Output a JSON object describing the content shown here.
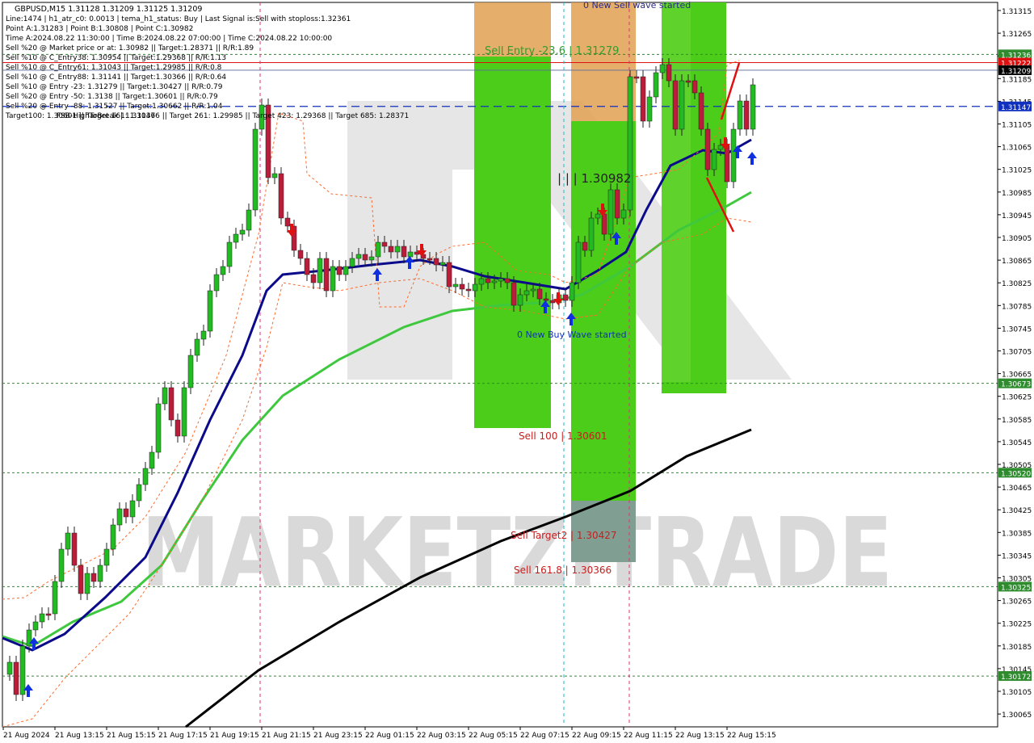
{
  "header": {
    "symbol_line": "GBPUSD,M15  1.31128 1.31209 1.31125 1.31209",
    "info_lines": [
      "Line:1474  |  h1_atr_c0: 0.0013  |  tema_h1_status: Buy  |  Last Signal is:Sell with stoploss:1.32361",
      "Point A:1.31283  |  Point B:1.30808  |  Point C:1.30982",
      "Time A:2024.08.22 11:30:00  |  Time B:2024.08.22 07:00:00  |  Time C:2024.08.22 10:00:00",
      "Sell %20 @ Market price or at: 1.30982  ||  Target:1.28371  ||  R/R:1.89",
      "Sell %10 @ C_Entry38: 1.30954  ||  Target:1.29368  ||  R/R:1.13",
      "Sell %10 @ C_Entry61: 1.31043  ||  Target:1.29985  ||  R/R:0.8",
      "Sell %10 @ C_Entry88: 1.31141  ||  Target:1.30366  ||  R/R:0.64",
      "Sell %10 @ Entry -23: 1.31279  ||  Target:1.30427  ||  R/R:0.79",
      "Sell %20 @ Entry -50: 1.3138  ||  Target:1.30601  ||  R/R:0.79",
      "Sell %20 @ Entry -88: 1.31527  ||  Target:1.30662  ||  R/R:1.04",
      "Target100: 1.30601  ||  Target 161: 1.30366  ||  Target 261: 1.29985  ||  Target 423: 1.29368  ||  Target 685: 1.28371"
    ],
    "fsb_label": "FSB-HighToBreak  |  1.31147"
  },
  "watermark": "MARKETZITRADE",
  "chart_data": {
    "type": "candlestick",
    "symbol": "GBPUSD",
    "timeframe": "M15",
    "ylim": [
      1.30085,
      1.31325
    ],
    "y_ticks": [
      "1.31325",
      "1.31285",
      "1.31245",
      "1.31205",
      "1.31165",
      "1.31125",
      "1.31085",
      "1.31045",
      "1.31005",
      "1.30965",
      "1.30925",
      "1.30885",
      "1.30845",
      "1.30805",
      "1.30765",
      "1.30725",
      "1.30685",
      "1.30645",
      "1.30605",
      "1.30565",
      "1.30525",
      "1.30485",
      "1.30445",
      "1.30405",
      "1.30365",
      "1.30325",
      "1.30285",
      "1.30245",
      "1.30205",
      "1.30165",
      "1.30125",
      "1.30085"
    ],
    "y_tick_labels": [
      "1.31315",
      "1.31265",
      "1.31225",
      "1.31185",
      "1.31145",
      "1.31105",
      "1.31065",
      "1.31025",
      "1.30985",
      "1.30945",
      "1.30905",
      "1.30865",
      "1.30825",
      "1.30785",
      "1.30745",
      "1.30705",
      "1.30665",
      "1.30625",
      "1.30585",
      "1.30545",
      "1.30505",
      "1.30465",
      "1.30425",
      "1.30385",
      "1.30345",
      "1.30305",
      "1.30265",
      "1.30225",
      "1.30185",
      "1.30145",
      "1.30105",
      "1.30065"
    ],
    "x_labels": [
      "21 Aug 2024",
      "21 Aug 13:15",
      "21 Aug 15:15",
      "21 Aug 17:15",
      "21 Aug 19:15",
      "21 Aug 21:15",
      "21 Aug 23:15",
      "22 Aug 01:15",
      "22 Aug 03:15",
      "22 Aug 05:15",
      "22 Aug 07:15",
      "22 Aug 09:15",
      "22 Aug 11:15",
      "22 Aug 13:15",
      "22 Aug 15:15"
    ],
    "price_tags": [
      {
        "label": "1.31236",
        "value": 1.31236,
        "color": "#2e8b2e"
      },
      {
        "label": "1.31222",
        "value": 1.31222,
        "color": "#e01010"
      },
      {
        "label": "1.31209",
        "value": 1.31209,
        "color": "#000000"
      },
      {
        "label": "1.31147",
        "value": 1.31147,
        "color": "#1030c0"
      },
      {
        "label": "1.30673",
        "value": 1.30673,
        "color": "#2e8b2e"
      },
      {
        "label": "1.30520",
        "value": 1.3052,
        "color": "#2e8b2e"
      },
      {
        "label": "1.30325",
        "value": 1.30325,
        "color": "#2e8b2e"
      },
      {
        "label": "1.30172",
        "value": 1.30172,
        "color": "#2e8b2e"
      }
    ],
    "annotations": [
      {
        "text": "Sell Entry -23.6 | 1.31279",
        "color": "#2e9e2e"
      },
      {
        "text": "0 New Sell wave started",
        "color": "#2a2a8a"
      },
      {
        "text": "| | | 1.30982",
        "color": "#222222"
      },
      {
        "text": "0 New Buy Wave started",
        "color": "#1030c0"
      },
      {
        "text": "Sell 100 | 1.30601",
        "color": "#c81e1e"
      },
      {
        "text": "Sell Target2 | 1.30427",
        "color": "#c81e1e"
      },
      {
        "text": "Sell 161.8 | 1.30366",
        "color": "#c81e1e"
      }
    ],
    "colors": {
      "bull": "#22bb22",
      "bear": "#bb1c3a",
      "zone_green": "#4ccd19",
      "zone_orange": "#e0a050",
      "ma_blue": "#0a0a8a",
      "ma_green": "#3ec83e",
      "ma_black": "#000000",
      "signal_blue": "#1030e0",
      "signal_red": "#e01010"
    }
  }
}
